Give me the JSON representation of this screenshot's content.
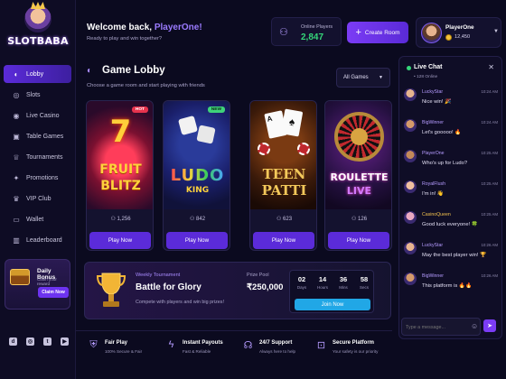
{
  "brand": {
    "name": "SLOTBABA"
  },
  "sidebar": {
    "items": [
      {
        "label": "Lobby",
        "icon": "controller-icon",
        "glyph": "◐",
        "active": true
      },
      {
        "label": "Slots",
        "icon": "slot-icon",
        "glyph": "◎"
      },
      {
        "label": "Live Casino",
        "icon": "live-icon",
        "glyph": "◉"
      },
      {
        "label": "Table Games",
        "icon": "table-icon",
        "glyph": "▣"
      },
      {
        "label": "Tournaments",
        "icon": "trophy-icon",
        "glyph": "♕"
      },
      {
        "label": "Promotions",
        "icon": "gift-icon",
        "glyph": "✦"
      },
      {
        "label": "VIP Club",
        "icon": "crown-icon",
        "glyph": "♛"
      },
      {
        "label": "Wallet",
        "icon": "wallet-icon",
        "glyph": "▭"
      },
      {
        "label": "Leaderboard",
        "icon": "chart-icon",
        "glyph": "▥"
      }
    ],
    "bonus": {
      "title": "Daily Bonus",
      "subtitle": "Claim your reward",
      "button": "Claim Now"
    },
    "socials": [
      "discord-icon",
      "instagram-icon",
      "twitter-icon",
      "youtube-icon"
    ]
  },
  "header": {
    "welcome": "Welcome back, ",
    "username": "PlayerOne!",
    "subtitle": "Ready to play and win together?",
    "online_label": "Online Players",
    "online_count": "2,847",
    "create_room": "Create Room",
    "profile": {
      "name": "PlayerOne",
      "coins": "12,450"
    }
  },
  "lobby": {
    "title": "Game Lobby",
    "subtitle": "Choose a game room and start playing with friends",
    "filter": "All Games",
    "games": [
      {
        "title_line1": "FRUIT",
        "title_line2": "BLITZ",
        "players": "1,256",
        "badge": "HOT",
        "button": "Play Now"
      },
      {
        "title_line1": "LUDO",
        "title_line2": "KING",
        "players": "842",
        "badge": "NEW",
        "button": "Play Now"
      },
      {
        "title_line1": "TEEN",
        "title_line2": "PATTI",
        "players": "623",
        "badge": "",
        "button": "Play Now"
      },
      {
        "title_line1": "ROULETTE",
        "title_line2": "LIVE",
        "players": "126",
        "badge": "",
        "button": "Play Now"
      }
    ]
  },
  "tournament": {
    "label": "Weekly Tournament",
    "title": "Battle for Glory",
    "subtitle": "Compete with players and win big prizes!",
    "prize_label": "Prize Pool",
    "prize_value": "₹250,000",
    "timer": [
      {
        "value": "02",
        "unit": "Days"
      },
      {
        "value": "14",
        "unit": "Hours"
      },
      {
        "value": "36",
        "unit": "Mins"
      },
      {
        "value": "58",
        "unit": "Secs"
      }
    ],
    "button": "Join Now"
  },
  "features": [
    {
      "title": "Fair Play",
      "subtitle": "100% Secure & Fair",
      "icon": "shield-icon",
      "glyph": "⛨"
    },
    {
      "title": "Instant Payouts",
      "subtitle": "Fast & Reliable",
      "icon": "lightning-icon",
      "glyph": "ϟ"
    },
    {
      "title": "24/7 Support",
      "subtitle": "Always here to help",
      "icon": "headset-icon",
      "glyph": "☊"
    },
    {
      "title": "Secure Platform",
      "subtitle": "Your safety is our priority",
      "icon": "lock-icon",
      "glyph": "⊡"
    }
  ],
  "chat": {
    "title": "Live Chat",
    "online": "• 128 Online",
    "messages": [
      {
        "user": "LuckyStar",
        "time": "10:24 AM",
        "text": "Nice win! 🎉",
        "color": "#b59bff"
      },
      {
        "user": "BigWinner",
        "time": "10:24 AM",
        "text": "Let's gooooo! 🔥",
        "color": "#b59bff"
      },
      {
        "user": "PlayerOne",
        "time": "10:25 AM",
        "text": "Who's up for Ludo?",
        "color": "#b59bff"
      },
      {
        "user": "RoyalFlush",
        "time": "10:25 AM",
        "text": "I'm in! 👋",
        "color": "#b59bff"
      },
      {
        "user": "CasinoQueen",
        "time": "10:25 AM",
        "text": "Good luck everyone! 🍀",
        "color": "#f2c14e"
      },
      {
        "user": "LuckyStar",
        "time": "10:26 AM",
        "text": "May the best player win! 🏆",
        "color": "#b59bff"
      },
      {
        "user": "BigWinner",
        "time": "10:26 AM",
        "text": "This platform is 🔥🔥",
        "color": "#b59bff"
      }
    ],
    "placeholder": "Type a message..."
  },
  "colors": {
    "accent": "#5b2bd9",
    "online": "#35d67a",
    "join": "#21a7e6"
  }
}
